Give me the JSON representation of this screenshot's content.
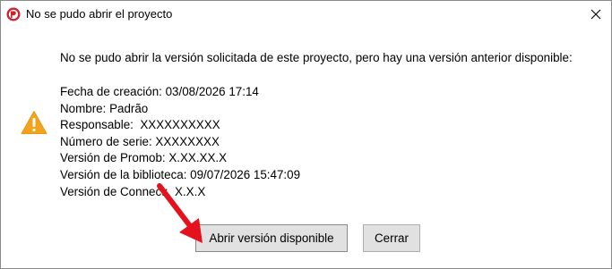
{
  "window": {
    "title": "No se pudo abrir el proyecto",
    "app_icon": "promob-app-icon",
    "close_icon": "close-icon"
  },
  "dialog": {
    "message": "No se pudo abrir la versión solicitada de este proyecto, pero hay una versión anterior disponible:",
    "info_lines": [
      "Fecha de creación: 03/08/2026 17:14",
      "Nombre: Padrão",
      "Responsable:  XXXXXXXXXX",
      "Número de serie: XXXXXXXX",
      "Versión de Promob: X.XX.XX.X",
      "Versión de la biblioteca: 09/07/2026 15:47:09",
      "Versión de Connect:  X.X.X"
    ],
    "warning_icon": "warning-icon",
    "annotation_icon": "red-arrow-icon"
  },
  "buttons": {
    "open_available": "Abrir versión disponible",
    "close": "Cerrar"
  },
  "colors": {
    "warning": "#f2a21b",
    "annotation_arrow": "#e5121d",
    "app_icon": "#d0212a"
  }
}
